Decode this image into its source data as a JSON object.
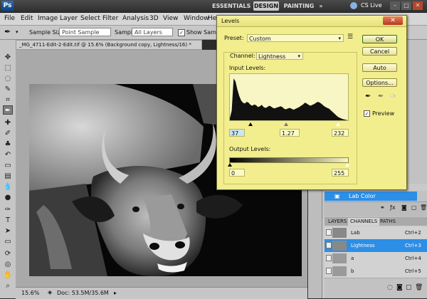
{
  "appbar": {
    "logo": "Ps",
    "workspaces": [
      "ESSENTIALS",
      "DESIGN",
      "PAINTING",
      "»"
    ],
    "cs_live": "CS Live",
    "window_controls": [
      "–",
      "□",
      "✕"
    ]
  },
  "menubar": {
    "items": [
      "File",
      "Edit",
      "Image",
      "Layer",
      "Select",
      "Filter",
      "Analysis",
      "3D",
      "View",
      "Window",
      "Help"
    ]
  },
  "options": {
    "sample_size_label": "Sample Size:",
    "sample_size_value": "Point Sample",
    "sample_label": "Sample:",
    "sample_value": "All Layers",
    "show_sampling": "Show Sampli"
  },
  "document": {
    "tab_title": "_MG_4711-Edit-2-Edit.tif @ 15.6% (Background copy, Lightness/16) *",
    "zoom": "15.6%",
    "doc_info": "Doc: 53.5M/35.6M"
  },
  "levels": {
    "title": "Levels",
    "preset_label": "Preset:",
    "preset_value": "Custom",
    "channel_label": "Channel:",
    "channel_value": "Lightness",
    "input_label": "Input Levels:",
    "input_black": "37",
    "input_gamma": "1.27",
    "input_white": "232",
    "output_label": "Output Levels:",
    "output_black": "0",
    "output_white": "255",
    "buttons": {
      "ok": "OK",
      "cancel": "Cancel",
      "auto": "Auto",
      "options": "Options..."
    },
    "preview_label": "Preview",
    "preview_checked": true,
    "histogram": [
      0.05,
      0.22,
      0.95,
      0.88,
      0.7,
      0.55,
      0.45,
      0.4,
      0.38,
      0.42,
      0.4,
      0.35,
      0.33,
      0.36,
      0.34,
      0.3,
      0.32,
      0.35,
      0.3,
      0.28,
      0.3,
      0.33,
      0.31,
      0.28,
      0.27,
      0.29,
      0.3,
      0.32,
      0.3,
      0.26,
      0.25,
      0.27,
      0.28,
      0.26,
      0.24,
      0.26,
      0.28,
      0.3,
      0.33,
      0.36,
      0.4,
      0.38,
      0.35,
      0.33,
      0.35,
      0.37,
      0.4,
      0.42,
      0.4,
      0.37,
      0.33,
      0.3,
      0.28,
      0.26,
      0.22,
      0.18,
      0.14,
      0.1,
      0.07,
      0.05,
      0.03,
      0.02,
      0.01,
      0.0
    ]
  },
  "layers": {
    "selected_layer": "Lab Color"
  },
  "channels": {
    "tabs": [
      "LAYERS",
      "CHANNELS",
      "PATHS"
    ],
    "rows": [
      {
        "name": "Lab",
        "shortcut": "Ctrl+2",
        "selected": false
      },
      {
        "name": "Lightness",
        "shortcut": "Ctrl+3",
        "selected": true
      },
      {
        "name": "a",
        "shortcut": "Ctrl+4",
        "selected": false
      },
      {
        "name": "b",
        "shortcut": "Ctrl+5",
        "selected": false
      }
    ]
  }
}
